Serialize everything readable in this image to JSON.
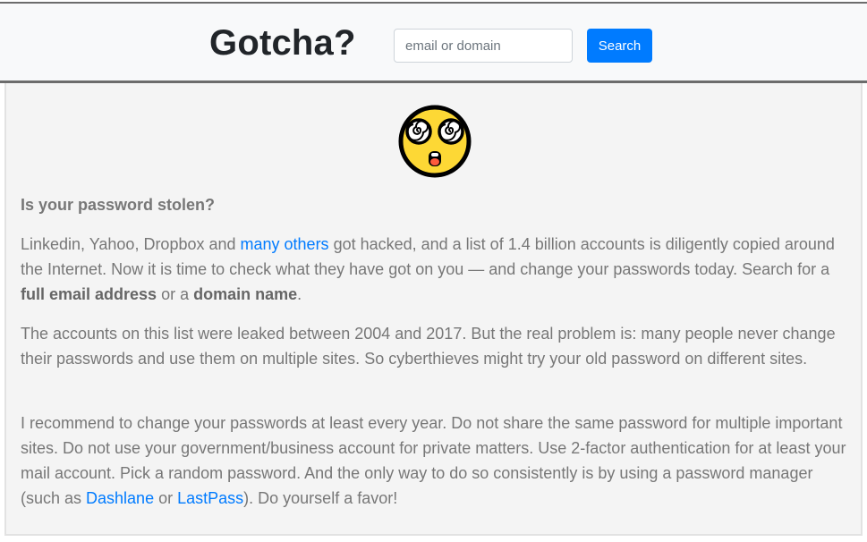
{
  "header": {
    "title": "Gotcha?",
    "search_placeholder": "email or domain",
    "search_value": "",
    "search_button_label": "Search"
  },
  "icons": {
    "hero": "dizzy-face-icon"
  },
  "colors": {
    "accent": "#007bff",
    "text": "#777777",
    "emoji_face": "#fdd835",
    "border": "#6c6c6c"
  },
  "main": {
    "heading": "Is your password stolen?",
    "p1": {
      "part1": "Linkedin, Yahoo, Dropbox and ",
      "link1": "many others",
      "part2": " got hacked, and a list of 1.4 billion accounts is diligently copied around the Internet. Now it is time to check what they have got on you — and change your passwords today. Search for a ",
      "bold1": "full email address",
      "part3": " or a ",
      "bold2": "domain name",
      "part4": "."
    },
    "p2": {
      "text": "The accounts on this list were leaked between 2004 and 2017. But the real problem is: many people never change their passwords and use them on multiple sites. So cyberthieves might try your old password on different sites."
    },
    "p3": {
      "part1": "I recommend to change your passwords at least every year. Do not share the same password for multiple important sites. Do not use your government/business account for private matters. Use 2-factor authentication for at least your mail account. Pick a random password. And the only way to do so consistently is by using a password manager (such as ",
      "link1": "Dashlane",
      "part2": " or ",
      "link2": "LastPass",
      "part3": "). Do yourself a favor!"
    }
  }
}
